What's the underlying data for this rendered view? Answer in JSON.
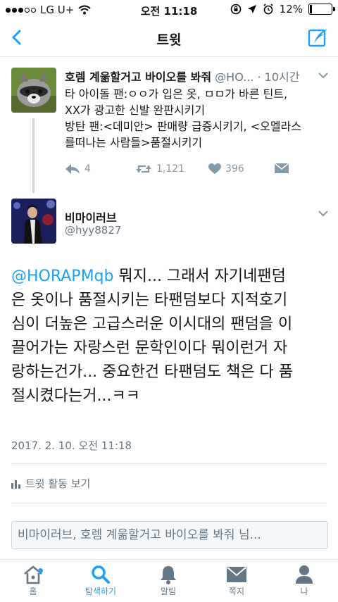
{
  "status_bar": {
    "carrier": "LG U+",
    "time": "오전 11:18",
    "battery": "12%",
    "battery_level": 0.12
  },
  "nav": {
    "title": "트윗"
  },
  "tweet1": {
    "name": "호렘 계욺할거고 바이오를 봐줘",
    "handle_time": "@HO... · 10시간",
    "lines": [
      "타 아이돌 팬:ㅇㅇ가 입은 옷, ㅁㅁ가 바른 틴트,",
      "XX가 광고한 신발 완판시키기",
      "방탄 팬:<데미안> 판매량 급증시키기, <오멜라스",
      "를떠나는 사람들>품절시키기"
    ],
    "replies": "4",
    "retweets": "1,121",
    "likes": "396"
  },
  "tweet2": {
    "name": "비마이러브",
    "handle": "@hyy8827",
    "mention": "@HORAPMqb",
    "line1_rest": " 뭐지... 그래서 자기네팬덤",
    "lines": [
      "은 옷이나 품절시키는 타팬덤보다  지적호기",
      "심이 더높은 고급스러운 이시대의 팬덤을 이",
      "끌어가는 자랑스런 문학인이다 뭐이런거 자",
      "랑하는건가... 중요한건 타팬덤도 책은 다 품",
      "절시켰다는거...ㅋㅋ"
    ],
    "timestamp": "2017. 2. 10. 오전 11:18",
    "activity": "트윗 활동 보기"
  },
  "reply_box": {
    "placeholder": "비마이러브, 호렘 계욺할거고 바이오를 봐줘 님..."
  },
  "tabs": [
    {
      "label": "홈",
      "icon": "home-icon"
    },
    {
      "label": "탐색하기",
      "icon": "search-icon"
    },
    {
      "label": "알림",
      "icon": "bell-icon"
    },
    {
      "label": "쪽지",
      "icon": "envelope-icon"
    },
    {
      "label": "나",
      "icon": "person-icon"
    }
  ],
  "colors": {
    "accent": "#1da1f2",
    "muted": "#657786",
    "icon_gray": "#8899a6"
  }
}
